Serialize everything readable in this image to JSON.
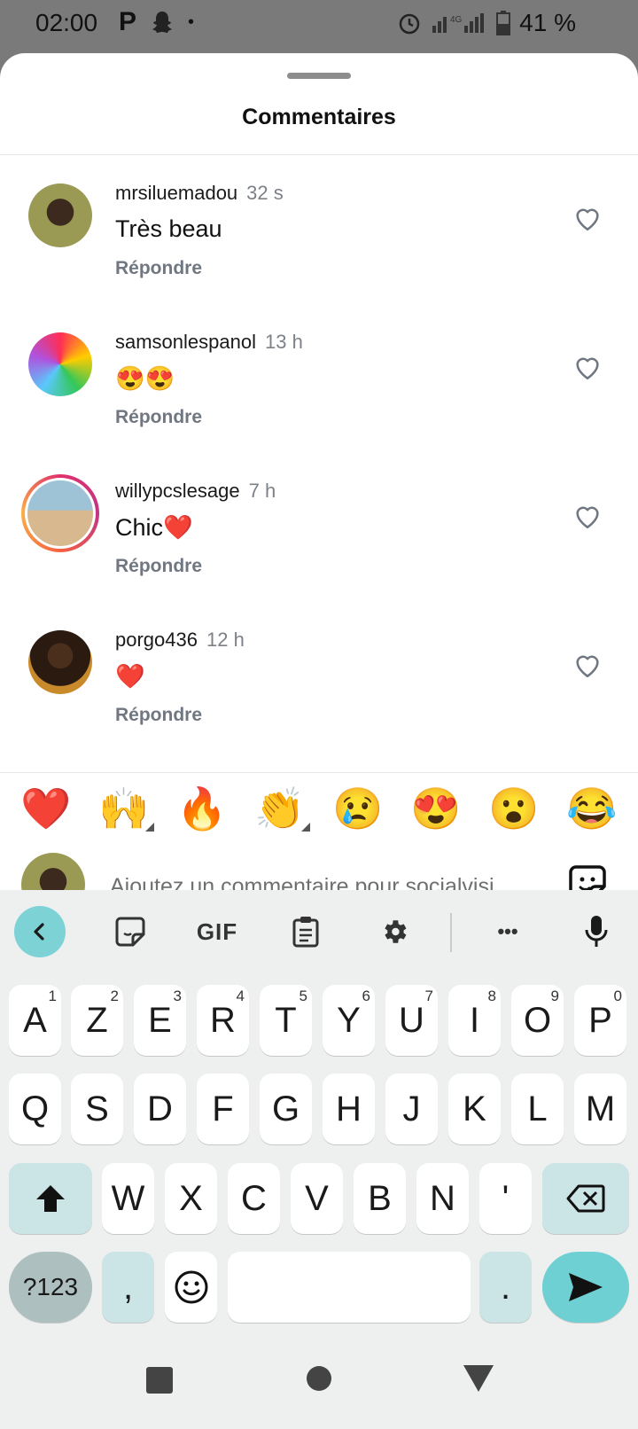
{
  "status_bar": {
    "time": "02:00",
    "battery": "41 %",
    "network": "4G"
  },
  "sheet": {
    "title": "Commentaires"
  },
  "comments": [
    {
      "username": "mrsiluemadou",
      "time": "32 s",
      "text": "Très beau",
      "reply": "Répondre"
    },
    {
      "username": "samsonlespanol",
      "time": "13 h",
      "text": "😍😍",
      "reply": "Répondre"
    },
    {
      "username": "willypcslesage",
      "time": "7 h",
      "text": "Chic❤️",
      "reply": "Répondre"
    },
    {
      "username": "porgo436",
      "time": "12 h",
      "text": "❤️",
      "reply": "Répondre"
    }
  ],
  "reactions": [
    "❤️",
    "🙌",
    "🔥",
    "👏",
    "😢",
    "😍",
    "😮",
    "😂"
  ],
  "composer": {
    "placeholder": "Ajoutez un commentaire pour socialvisi"
  },
  "keyboard": {
    "toolbar": {
      "gif_label": "GIF",
      "more_label": "•••"
    },
    "row1": [
      {
        "k": "A",
        "h": "1"
      },
      {
        "k": "Z",
        "h": "2"
      },
      {
        "k": "E",
        "h": "3"
      },
      {
        "k": "R",
        "h": "4"
      },
      {
        "k": "T",
        "h": "5"
      },
      {
        "k": "Y",
        "h": "6"
      },
      {
        "k": "U",
        "h": "7"
      },
      {
        "k": "I",
        "h": "8"
      },
      {
        "k": "O",
        "h": "9"
      },
      {
        "k": "P",
        "h": "0"
      }
    ],
    "row2": [
      "Q",
      "S",
      "D",
      "F",
      "G",
      "H",
      "J",
      "K",
      "L",
      "M"
    ],
    "row3": [
      "W",
      "X",
      "C",
      "V",
      "B",
      "N",
      "'"
    ],
    "symbols_label": "?123",
    "comma_label": ",",
    "period_label": "."
  },
  "colors": {
    "accent": "#7dd2d6",
    "key_special": "#cbe4e6",
    "text_muted": "#707781"
  }
}
